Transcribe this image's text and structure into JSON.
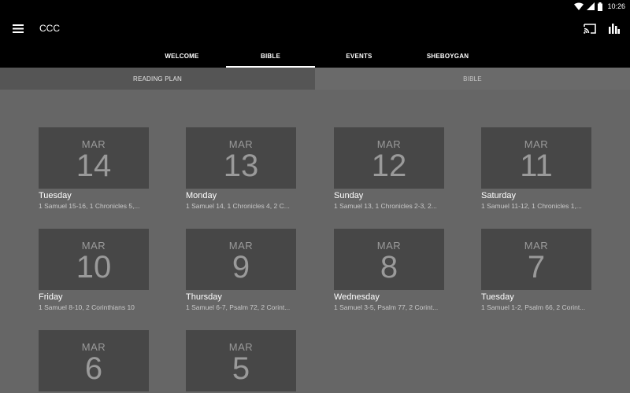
{
  "status": {
    "time": "10:26"
  },
  "app": {
    "title": "CCC"
  },
  "tabs": [
    {
      "label": "WELCOME"
    },
    {
      "label": "BIBLE"
    },
    {
      "label": "EVENTS"
    },
    {
      "label": "SHEBOYGAN"
    }
  ],
  "subtabs": [
    {
      "label": "READING PLAN"
    },
    {
      "label": "BIBLE"
    }
  ],
  "cards": [
    {
      "month": "MAR",
      "day": "14",
      "weekday": "Tuesday",
      "readings": "1 Samuel 15-16, 1 Chronicles 5,..."
    },
    {
      "month": "MAR",
      "day": "13",
      "weekday": "Monday",
      "readings": "1 Samuel 14, 1 Chronicles 4, 2 C..."
    },
    {
      "month": "MAR",
      "day": "12",
      "weekday": "Sunday",
      "readings": "1 Samuel 13, 1 Chronicles 2-3, 2..."
    },
    {
      "month": "MAR",
      "day": "11",
      "weekday": "Saturday",
      "readings": "1 Samuel 11-12, 1 Chronicles 1,..."
    },
    {
      "month": "MAR",
      "day": "10",
      "weekday": "Friday",
      "readings": "1 Samuel 8-10, 2 Corinthians 10"
    },
    {
      "month": "MAR",
      "day": "9",
      "weekday": "Thursday",
      "readings": "1 Samuel 6-7, Psalm 72, 2 Corint..."
    },
    {
      "month": "MAR",
      "day": "8",
      "weekday": "Wednesday",
      "readings": "1 Samuel 3-5, Psalm 77, 2 Corint..."
    },
    {
      "month": "MAR",
      "day": "7",
      "weekday": "Tuesday",
      "readings": "1 Samuel 1-2, Psalm 66, 2 Corint..."
    },
    {
      "month": "MAR",
      "day": "6",
      "weekday": "",
      "readings": ""
    },
    {
      "month": "MAR",
      "day": "5",
      "weekday": "",
      "readings": ""
    }
  ]
}
